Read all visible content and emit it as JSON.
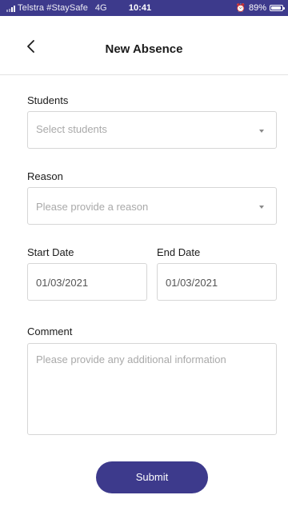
{
  "status_bar": {
    "carrier": "Telstra #StaySafe",
    "network": "4G",
    "time": "10:41",
    "battery": "89%",
    "battery_level": 0.89,
    "signal_bars": 2,
    "icons": [
      "signal-icon",
      "alarm-icon",
      "battery-icon"
    ],
    "background": "#3d3a8c"
  },
  "header": {
    "title": "New Absence",
    "back_icon": "chevron-left-icon"
  },
  "form": {
    "students": {
      "label": "Students",
      "placeholder": "Select students"
    },
    "reason": {
      "label": "Reason",
      "placeholder": "Please provide a reason"
    },
    "start_date": {
      "label": "Start Date",
      "value": "01/03/2021"
    },
    "end_date": {
      "label": "End Date",
      "value": "01/03/2021"
    },
    "comment": {
      "label": "Comment",
      "placeholder": "Please provide any additional information"
    }
  },
  "submit": {
    "label": "Submit"
  },
  "colors": {
    "accent": "#3d3a8c",
    "border": "#d6d6d6",
    "placeholder": "#a9a9a9"
  }
}
